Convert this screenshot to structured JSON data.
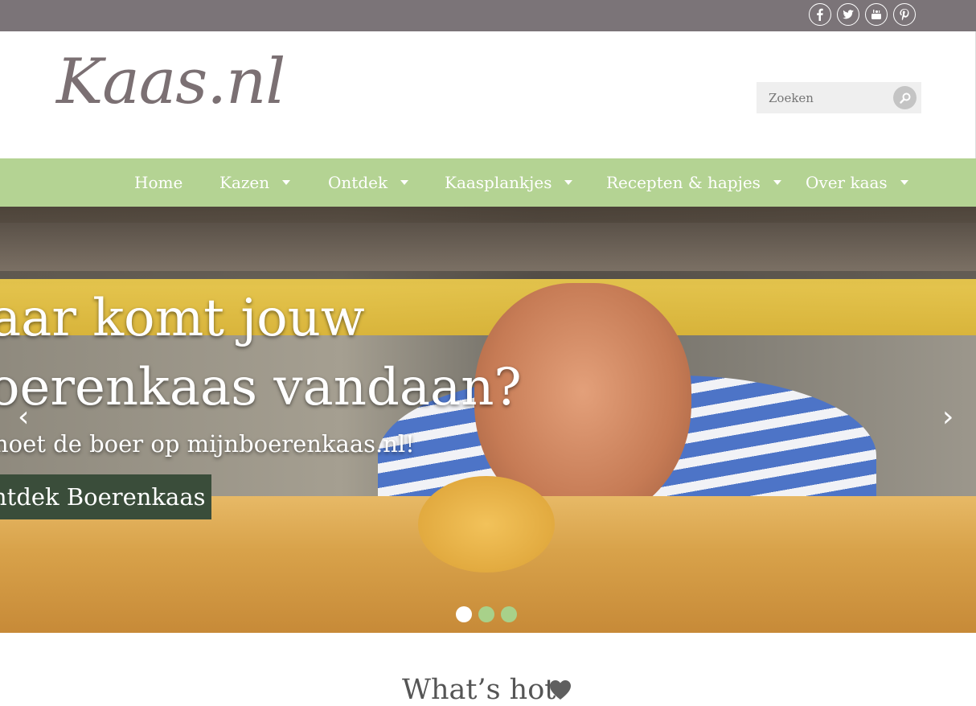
{
  "social": [
    {
      "name": "facebook-icon"
    },
    {
      "name": "twitter-icon"
    },
    {
      "name": "youtube-icon"
    },
    {
      "name": "pinterest-icon"
    }
  ],
  "header": {
    "logo": "Kaas.nl",
    "search": {
      "placeholder": "Zoeken"
    }
  },
  "nav": {
    "items": [
      {
        "label": "Home",
        "has_dropdown": false
      },
      {
        "label": "Kazen",
        "has_dropdown": true
      },
      {
        "label": "Ontdek",
        "has_dropdown": true
      },
      {
        "label": "Kaasplankjes",
        "has_dropdown": true
      },
      {
        "label": "Recepten & hapjes",
        "has_dropdown": true
      },
      {
        "label": "Over kaas",
        "has_dropdown": true
      }
    ]
  },
  "hero": {
    "line1": "aar komt jouw",
    "line2": "oerenkaas vandaan?",
    "sub": "noet de boer op mijnboerenkaas.nl!",
    "cta": "ntdek Boerenkaas",
    "slides": 3,
    "active_slide": 1
  },
  "section": {
    "title": "What’s hot"
  },
  "colors": {
    "topbar": "#7b7478",
    "nav": "#b4d393",
    "logo": "#7b7073",
    "cta_bg": "#3a4d3a",
    "dot_active": "#ffffff",
    "dot_inactive": "#a8d18a"
  }
}
